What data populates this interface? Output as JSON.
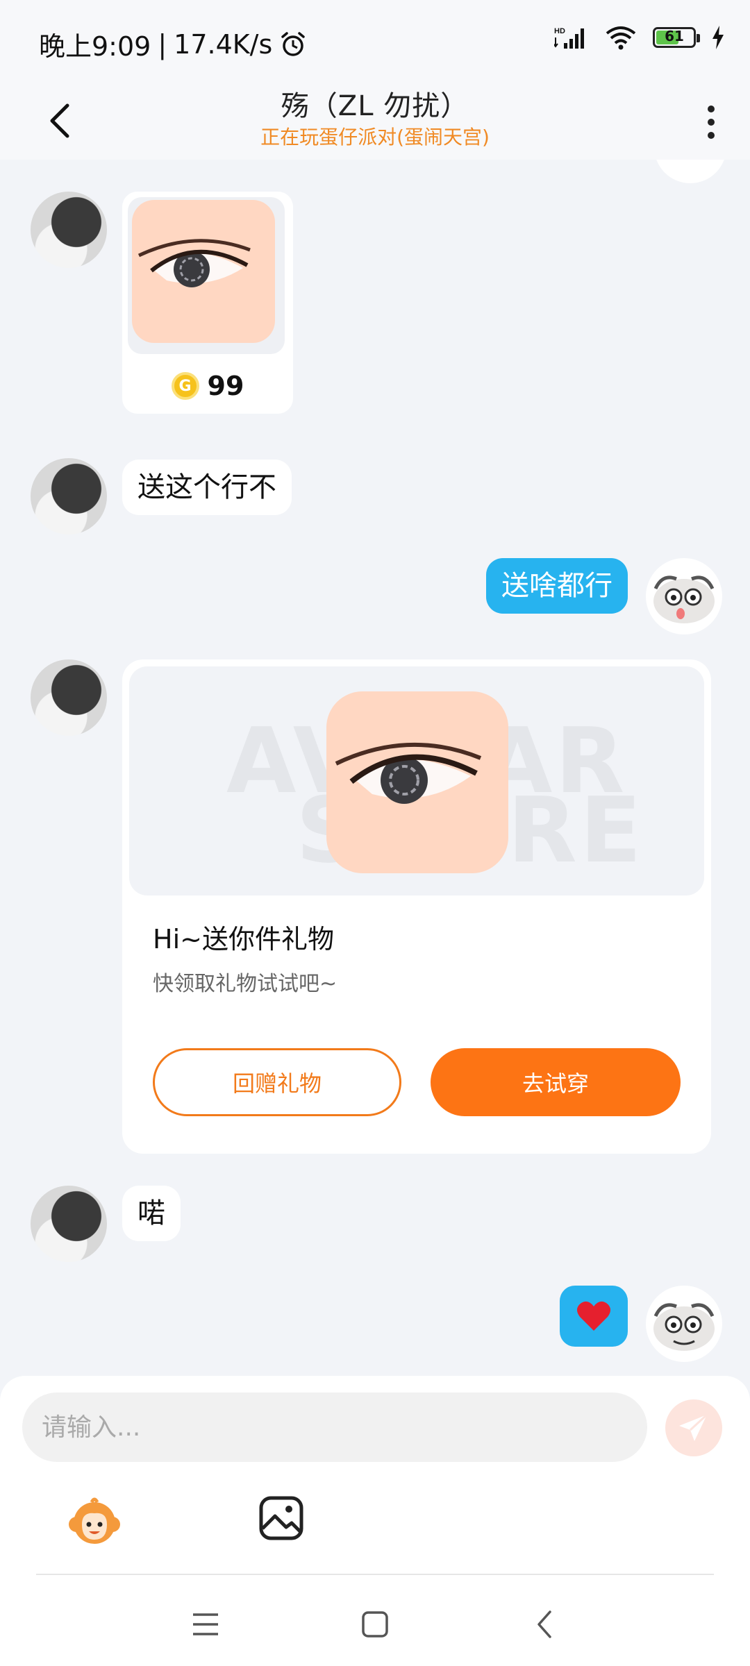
{
  "status_bar": {
    "time": "晚上9:09",
    "separator": "|",
    "net_speed": "17.4K/s",
    "battery_level": "61",
    "icons": [
      "alarm-icon",
      "hd-signal-icon",
      "wifi-icon",
      "battery-icon",
      "charging-icon"
    ]
  },
  "header": {
    "title": "殇（ZL  勿扰）",
    "subtitle": "正在玩蛋仔派对(蛋闹天宫)"
  },
  "messages": {
    "item_price": "99",
    "msg1": "送这个行不",
    "msg2": "送啥都行",
    "msg4": "喏"
  },
  "gift_card": {
    "watermark_line1": "AVATAR",
    "watermark_line2": "STORE",
    "title": "Hi~送你件礼物",
    "subtitle": "快领取礼物试试吧~",
    "return_gift_label": "回赠礼物",
    "try_on_label": "去试穿"
  },
  "input": {
    "placeholder": "请输入..."
  },
  "colors": {
    "accent_orange": "#fd7414",
    "outgoing_bubble": "#27b3ef",
    "subtitle_orange": "#f08a24"
  }
}
